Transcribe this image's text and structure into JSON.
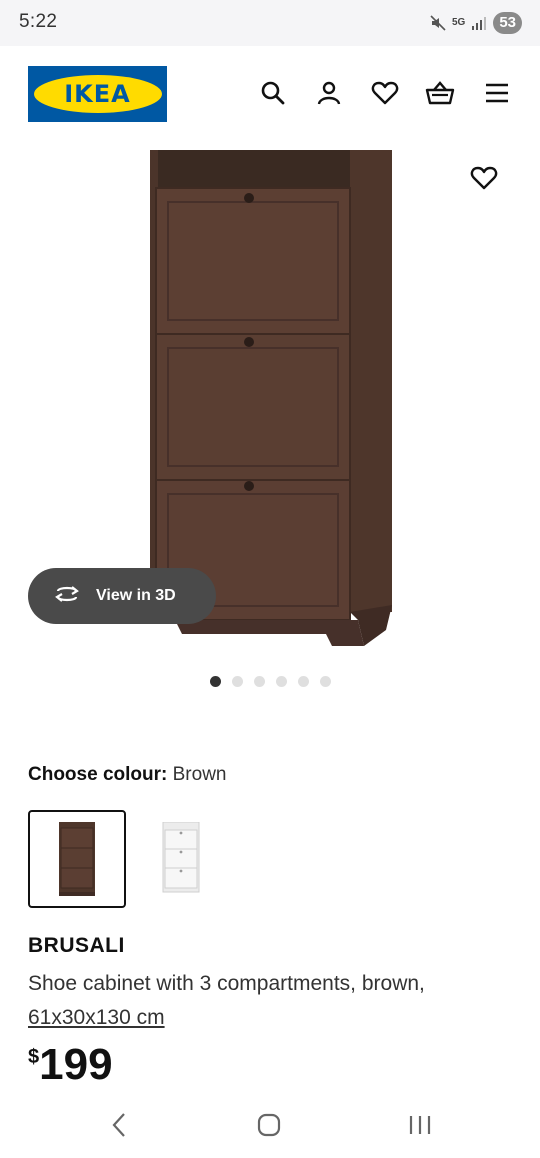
{
  "status_bar": {
    "time": "5:22",
    "network": "5G",
    "battery": "53",
    "icons": [
      "mute-icon",
      "5g-icon",
      "signal-icon",
      "battery-icon"
    ]
  },
  "header": {
    "logo_text": "IKEA",
    "brand_colors": {
      "blue": "#0058a3",
      "yellow": "#ffdb00"
    },
    "icons": [
      "search-icon",
      "account-icon",
      "favourites-icon",
      "cart-icon",
      "menu-icon"
    ]
  },
  "gallery": {
    "view_3d_label": "View in 3D",
    "image_count": 6,
    "active_index": 0
  },
  "colour": {
    "label": "Choose colour:",
    "value": "Brown",
    "options": [
      "Brown",
      "White"
    ],
    "selected": "Brown"
  },
  "product": {
    "name": "BRUSALI",
    "description": "Shoe cabinet with 3 compartments, brown,",
    "measurements": "61x30x130 cm",
    "price_currency": "$",
    "price_value": "199"
  },
  "nav_bar": {
    "icons": [
      "back-icon",
      "home-icon",
      "recents-icon"
    ]
  }
}
